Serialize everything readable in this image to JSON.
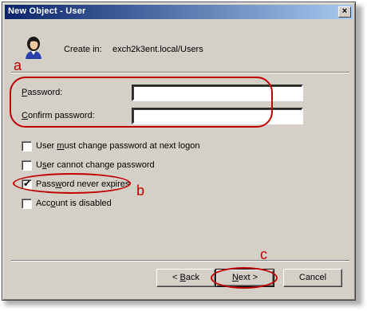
{
  "window": {
    "title": "New Object - User",
    "close_glyph": "×"
  },
  "header": {
    "icon": "user-icon",
    "create_in_label": "Create in:",
    "create_in_path": "exch2k3ent.local/Users"
  },
  "fields": {
    "password_label": "Password:",
    "password_value": "",
    "confirm_label": "Confirm password:",
    "confirm_value": ""
  },
  "options": [
    {
      "label": "User must change password at next logon",
      "checked": false
    },
    {
      "label": "User cannot change password",
      "checked": false
    },
    {
      "label": "Password never expires",
      "checked": true
    },
    {
      "label": "Account is disabled",
      "checked": false
    }
  ],
  "buttons": {
    "back": "< Back",
    "next": "Next >",
    "cancel": "Cancel"
  },
  "annotations": {
    "a": "a",
    "b": "b",
    "c": "c",
    "color": "#c00000"
  },
  "check_glyph": "✔"
}
